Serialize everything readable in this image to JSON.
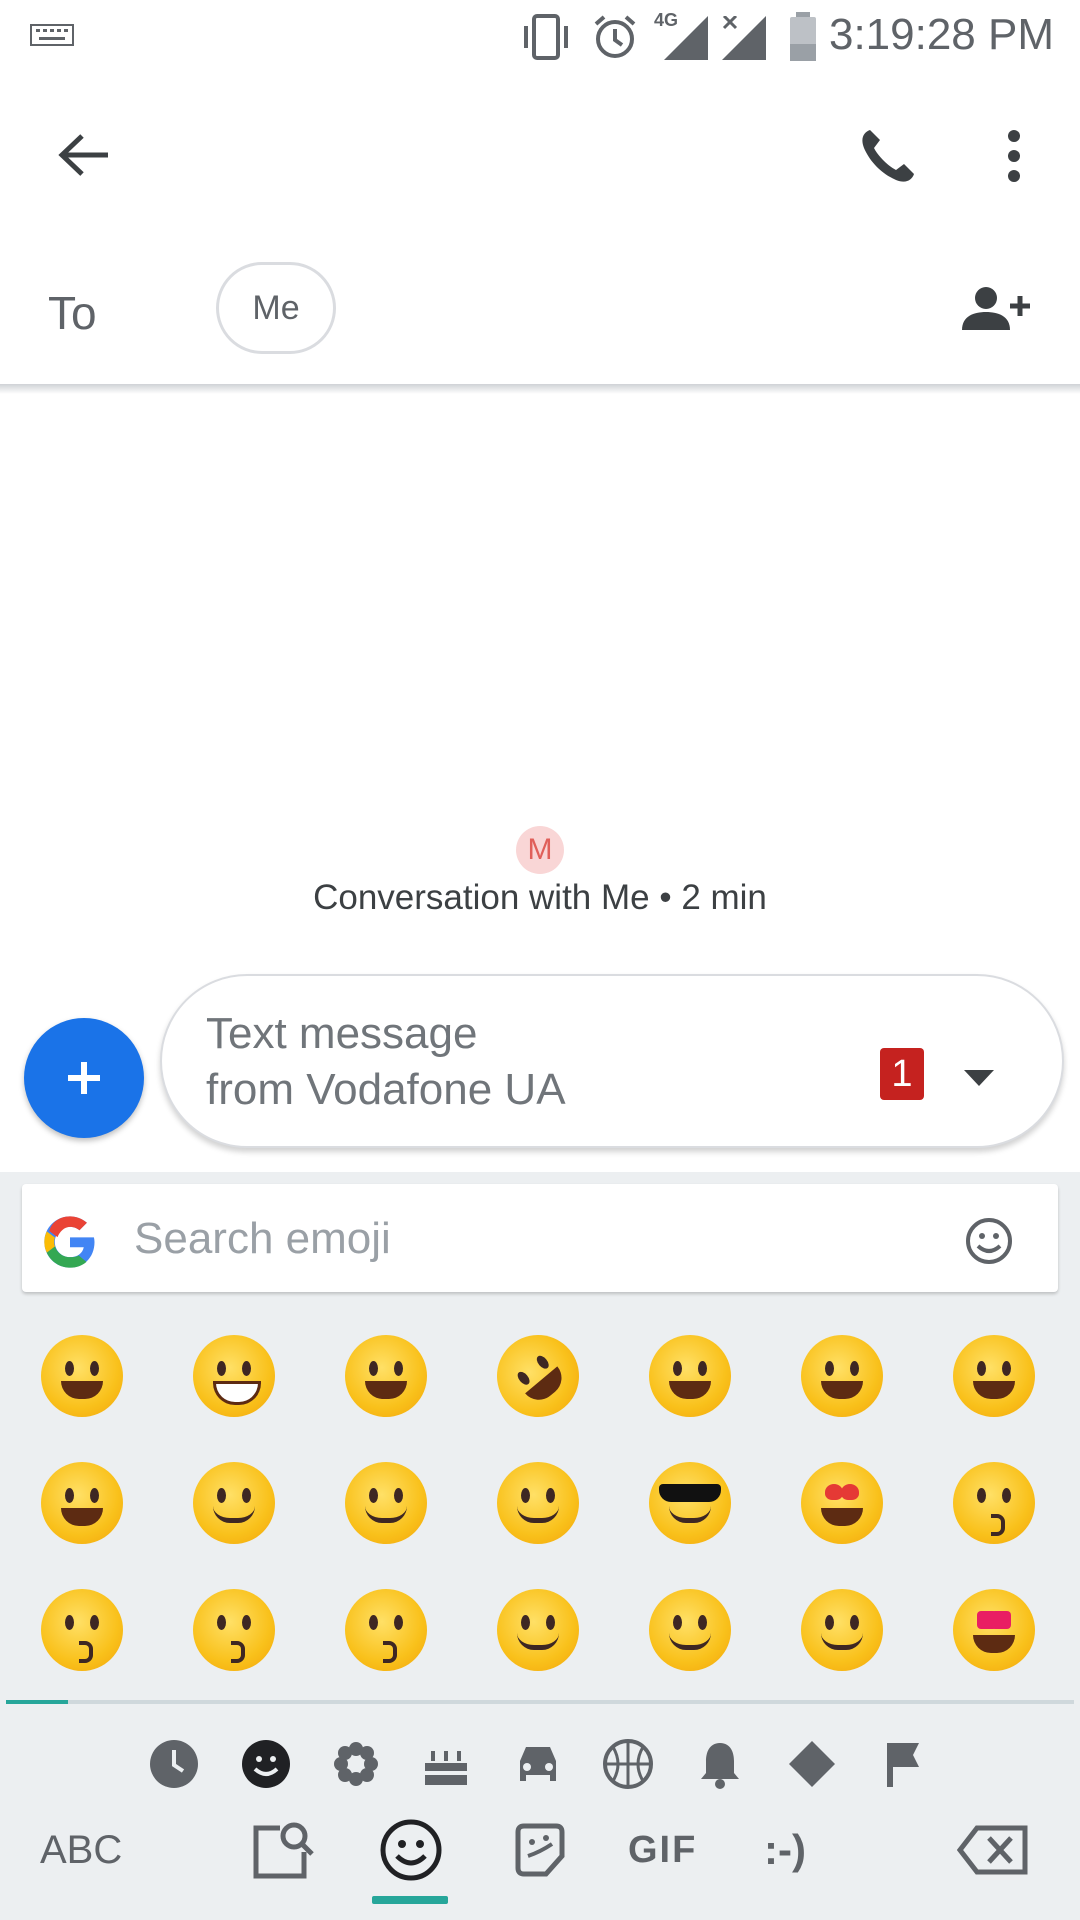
{
  "status_bar": {
    "time": "3:19:28 PM",
    "network": "4G"
  },
  "app_bar": {
    "back_icon": "arrow-back-icon",
    "call_icon": "phone-icon",
    "more_icon": "more-vert-icon"
  },
  "recipients": {
    "to_label": "To",
    "chip_label": "Me",
    "add_icon": "add-person-icon"
  },
  "conversation": {
    "avatar_letter": "M",
    "info": "Conversation with Me • 2 min"
  },
  "compose": {
    "placeholder_line1": "Text message",
    "placeholder_line2": "from Vodafone UA",
    "sim_badge": "1",
    "add_icon": "plus-icon",
    "dropdown_icon": "dropdown-arrow-icon"
  },
  "keyboard": {
    "search_placeholder": "Search emoji",
    "categories": [
      "recent-clock-icon",
      "smileys-icon",
      "nature-flower-icon",
      "food-cake-icon",
      "travel-car-icon",
      "activity-ball-icon",
      "objects-bell-icon",
      "symbols-diamond-icon",
      "flags-icon"
    ],
    "emoji_rows": [
      [
        "grinning",
        "beaming",
        "tears-of-joy",
        "rolling-laughing",
        "smiley",
        "smile",
        "sweat-smile"
      ],
      [
        "squinting-laugh",
        "wink",
        "blush",
        "yum",
        "sunglasses",
        "heart-eyes",
        "kiss-heart"
      ],
      [
        "kissing",
        "kissing-smiling-eyes",
        "kissing-closed-eyes",
        "smiling-eyes",
        "slight-smile",
        "hugging",
        "star-struck"
      ]
    ],
    "bottom_keys": {
      "abc": "ABC",
      "gif": "GIF",
      "emoticon": ":-)"
    }
  }
}
